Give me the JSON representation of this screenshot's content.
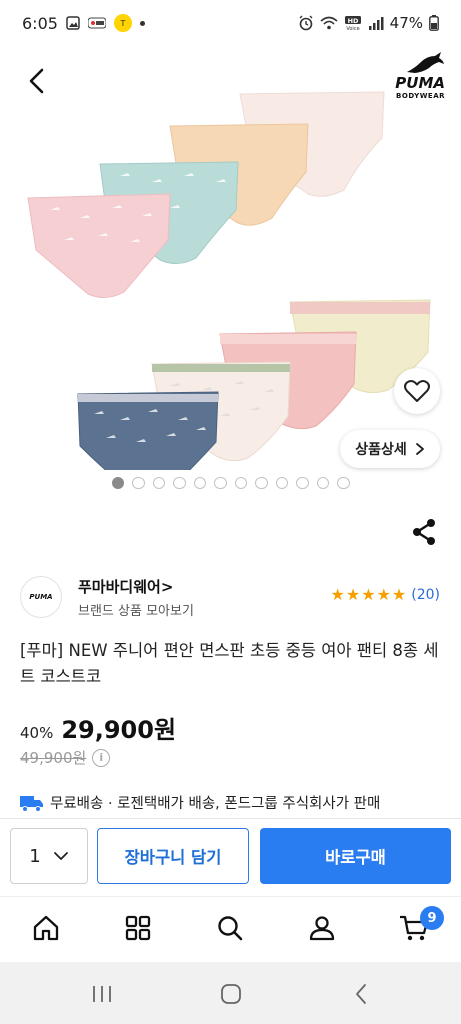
{
  "status_bar": {
    "time": "6:05",
    "battery": "47%",
    "icons": [
      "gallery-icon",
      "app-icon",
      "kakao-icon",
      "notification-dot-icon",
      "alarm-icon",
      "wifi-icon",
      "volte-icon",
      "signal-icon",
      "battery-icon"
    ]
  },
  "header": {
    "back_icon": "chevron-left-icon",
    "brand_logo_word": "PUMA",
    "brand_logo_sub": "BODYWEAR"
  },
  "gallery": {
    "total_images": 12,
    "active_index": 0,
    "wishlist_icon": "heart-icon",
    "detail_label": "상품상세",
    "detail_icon": "chevron-right-icon",
    "colors": {
      "pink": "#f6cfd2",
      "mint": "#b9dcd9",
      "peach": "#f6d8b4",
      "cream": "#f8ebe6",
      "yellow": "#f1eccc",
      "coral": "#f3c1bf",
      "sage": "#b6c4a8",
      "navy": "#5b7390"
    }
  },
  "share_icon": "share-icon",
  "brand": {
    "avatar_word": "PUMA",
    "name": "푸마바디웨어",
    "name_arrow": ">",
    "sub": "브랜드 상품 모아보기",
    "rating_stars": 5,
    "review_count": "(20)"
  },
  "product": {
    "title": "[푸마] NEW 주니어 편안 면스판 초등 중등 여아 팬티 8종 세트 코스트코",
    "discount": "40%",
    "price": "29,900원",
    "original_price": "49,900원",
    "info_icon": "i",
    "shipping_icon": "truck-icon",
    "shipping_text": "무료배송 · 로젠택배가 배송, 폰드그룹 주식회사가 판매"
  },
  "purchase": {
    "quantity": "1",
    "cart_label": "장바구니 담기",
    "buy_label": "바로구매",
    "colors": {
      "primary": "#2a7df0"
    }
  },
  "bottom_nav": {
    "items": [
      "home-icon",
      "category-icon",
      "search-icon",
      "my-page-icon",
      "cart-icon"
    ],
    "cart_badge": "9"
  },
  "system_nav": [
    "recent-apps-icon",
    "home-button-icon",
    "back-icon"
  ]
}
